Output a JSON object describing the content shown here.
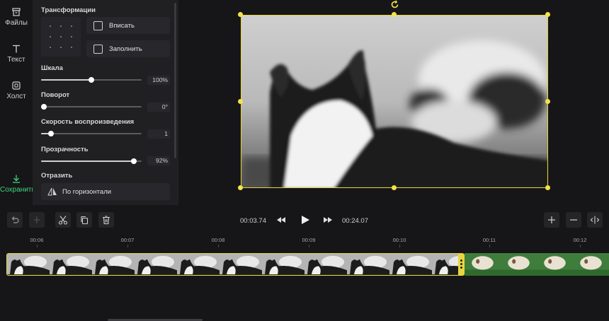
{
  "sidebar": {
    "items": [
      {
        "label": "Файлы",
        "icon": "archive-icon"
      },
      {
        "label": "Текст",
        "icon": "text-t-icon"
      },
      {
        "label": "Холст",
        "icon": "canvas-icon"
      }
    ],
    "save_label": "Сохранить",
    "save_color": "#3fd77a"
  },
  "panel": {
    "transform_title": "Трансформации",
    "fit_label": "Вписать",
    "fill_label": "Заполнить",
    "scale": {
      "label": "Шкала",
      "value_text": "100%",
      "level": 0.5
    },
    "rotation": {
      "label": "Поворот",
      "value_text": "0°",
      "level": 0.0
    },
    "speed": {
      "label": "Скорость воспроизведения",
      "value_text": "1",
      "level": 0.1
    },
    "opacity": {
      "label": "Прозрачность",
      "value_text": "92%",
      "level": 0.92
    },
    "flip": {
      "title": "Отразить",
      "button_label": "По горизонтали"
    }
  },
  "player": {
    "current_time": "00:03.74",
    "total_time": "00:24.07"
  },
  "timeline": {
    "ruler": [
      "00:06",
      "00:07",
      "00:08",
      "00:09",
      "00:10",
      "00:11",
      "00:12"
    ]
  },
  "colors": {
    "accent_yellow": "#e8d640",
    "background": "#161618",
    "panel": "#202023"
  }
}
